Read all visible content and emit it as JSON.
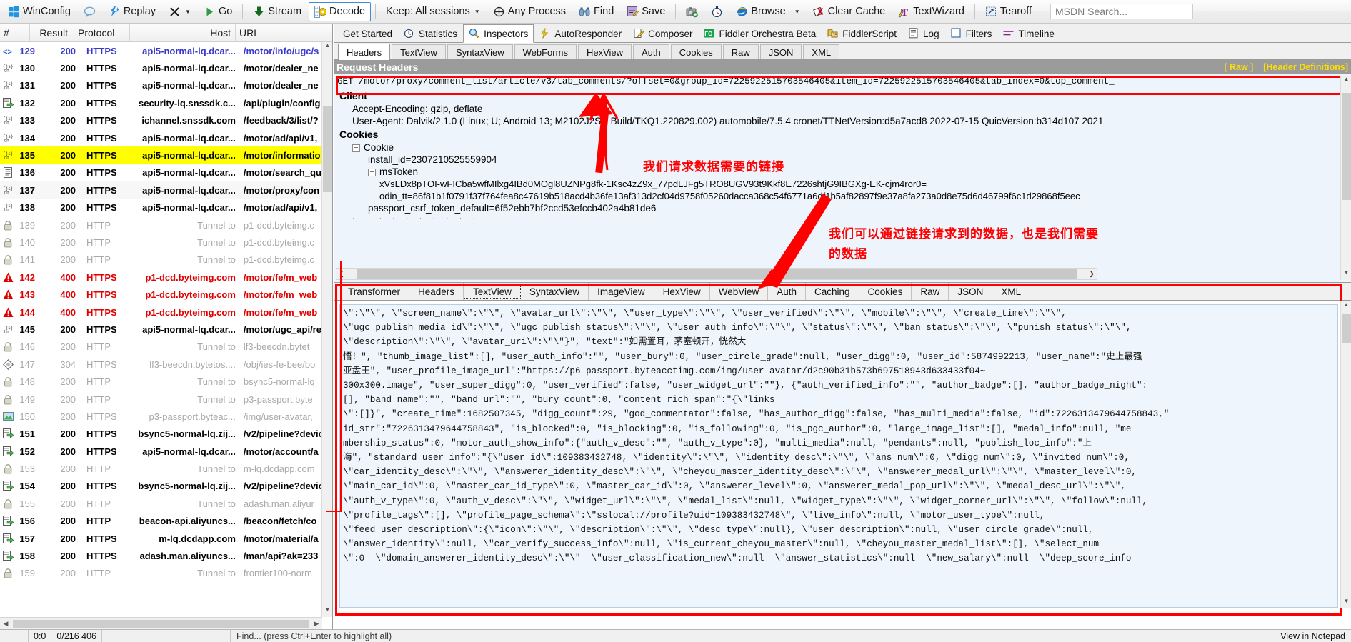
{
  "toolbar": {
    "items": [
      {
        "id": "winconfig",
        "label": "WinConfig",
        "icon": "windows-icon"
      },
      {
        "id": "comment",
        "label": "",
        "icon": "speech-bubble-icon"
      },
      {
        "id": "replay",
        "label": "Replay",
        "icon": "replay-icon"
      },
      {
        "id": "remove",
        "label": "",
        "icon": "x-icon",
        "caret": true
      },
      {
        "id": "go",
        "label": "Go",
        "icon": "play-icon"
      },
      {
        "id": "stream",
        "label": "Stream",
        "icon": "down-arrow-icon"
      },
      {
        "id": "decode",
        "label": "Decode",
        "icon": "decode-icon"
      },
      {
        "id": "keep",
        "label": "Keep: All sessions",
        "icon": "",
        "caret": true
      },
      {
        "id": "anyprocess",
        "label": "Any Process",
        "icon": "target-icon"
      },
      {
        "id": "find",
        "label": "Find",
        "icon": "binoculars-icon"
      },
      {
        "id": "save",
        "label": "Save",
        "icon": "save-icon"
      },
      {
        "id": "screenshot",
        "label": "",
        "icon": "camera-icon"
      },
      {
        "id": "timer",
        "label": "",
        "icon": "stopwatch-icon"
      },
      {
        "id": "browse",
        "label": "Browse",
        "icon": "ie-icon",
        "caret": true
      },
      {
        "id": "clearcache",
        "label": "Clear Cache",
        "icon": "clear-cache-icon"
      },
      {
        "id": "textwizard",
        "label": "TextWizard",
        "icon": "textwizard-icon"
      },
      {
        "id": "tearoff",
        "label": "Tearoff",
        "icon": "tearoff-icon"
      }
    ],
    "msdn_placeholder": "MSDN Search..."
  },
  "sessions": {
    "columns": [
      "#",
      "Result",
      "Protocol",
      "Host",
      "URL"
    ],
    "rows": [
      {
        "icon": "xml-icon",
        "num": "129",
        "result": "200",
        "protocol": "HTTPS",
        "host": "api5-normal-lq.dcar...",
        "url": "/motor/info/ugc/s",
        "style": "blue"
      },
      {
        "icon": "json-icon",
        "num": "130",
        "result": "200",
        "protocol": "HTTPS",
        "host": "api5-normal-lq.dcar...",
        "url": "/motor/dealer_ne",
        "style": "normal"
      },
      {
        "icon": "json-icon",
        "num": "131",
        "result": "200",
        "protocol": "HTTPS",
        "host": "api5-normal-lq.dcar...",
        "url": "/motor/dealer_ne",
        "style": "normal"
      },
      {
        "icon": "doc-arrow-icon",
        "num": "132",
        "result": "200",
        "protocol": "HTTPS",
        "host": "security-lq.snssdk.c...",
        "url": "/api/plugin/config",
        "style": "normal"
      },
      {
        "icon": "json-icon",
        "num": "133",
        "result": "200",
        "protocol": "HTTPS",
        "host": "ichannel.snssdk.com",
        "url": "/feedback/3/list/?",
        "style": "normal"
      },
      {
        "icon": "json-icon",
        "num": "134",
        "result": "200",
        "protocol": "HTTPS",
        "host": "api5-normal-lq.dcar...",
        "url": "/motor/ad/api/v1,",
        "style": "normal"
      },
      {
        "icon": "json-icon",
        "num": "135",
        "result": "200",
        "protocol": "HTTPS",
        "host": "api5-normal-lq.dcar...",
        "url": "/motor/informatio",
        "style": "selected"
      },
      {
        "icon": "text-icon",
        "num": "136",
        "result": "200",
        "protocol": "HTTPS",
        "host": "api5-normal-lq.dcar...",
        "url": "/motor/search_qu",
        "style": "normal"
      },
      {
        "icon": "json-icon",
        "num": "137",
        "result": "200",
        "protocol": "HTTPS",
        "host": "api5-normal-lq.dcar...",
        "url": "/motor/proxy/con",
        "style": "alt"
      },
      {
        "icon": "json-icon",
        "num": "138",
        "result": "200",
        "protocol": "HTTPS",
        "host": "api5-normal-lq.dcar...",
        "url": "/motor/ad/api/v1,",
        "style": "normal"
      },
      {
        "icon": "lock-icon",
        "num": "139",
        "result": "200",
        "protocol": "HTTP",
        "host": "Tunnel to",
        "url": "p1-dcd.byteimg.c",
        "style": "gray"
      },
      {
        "icon": "lock-icon",
        "num": "140",
        "result": "200",
        "protocol": "HTTP",
        "host": "Tunnel to",
        "url": "p1-dcd.byteimg.c",
        "style": "gray"
      },
      {
        "icon": "lock-icon",
        "num": "141",
        "result": "200",
        "protocol": "HTTP",
        "host": "Tunnel to",
        "url": "p1-dcd.byteimg.c",
        "style": "gray"
      },
      {
        "icon": "warning-icon",
        "num": "142",
        "result": "400",
        "protocol": "HTTPS",
        "host": "p1-dcd.byteimg.com",
        "url": "/motor/fe/m_web",
        "style": "red"
      },
      {
        "icon": "warning-icon",
        "num": "143",
        "result": "400",
        "protocol": "HTTPS",
        "host": "p1-dcd.byteimg.com",
        "url": "/motor/fe/m_web",
        "style": "red"
      },
      {
        "icon": "warning-icon",
        "num": "144",
        "result": "400",
        "protocol": "HTTPS",
        "host": "p1-dcd.byteimg.com",
        "url": "/motor/fe/m_web",
        "style": "red"
      },
      {
        "icon": "json-icon",
        "num": "145",
        "result": "200",
        "protocol": "HTTPS",
        "host": "api5-normal-lq.dcar...",
        "url": "/motor/ugc_api/re",
        "style": "normal"
      },
      {
        "icon": "lock-icon",
        "num": "146",
        "result": "200",
        "protocol": "HTTP",
        "host": "Tunnel to",
        "url": "lf3-beecdn.bytet",
        "style": "gray"
      },
      {
        "icon": "cache-icon",
        "num": "147",
        "result": "304",
        "protocol": "HTTPS",
        "host": "lf3-beecdn.bytetos....",
        "url": "/obj/ies-fe-bee/bo",
        "style": "gray"
      },
      {
        "icon": "lock-icon",
        "num": "148",
        "result": "200",
        "protocol": "HTTP",
        "host": "Tunnel to",
        "url": "bsync5-normal-lq",
        "style": "gray"
      },
      {
        "icon": "lock-icon",
        "num": "149",
        "result": "200",
        "protocol": "HTTP",
        "host": "Tunnel to",
        "url": "p3-passport.byte",
        "style": "gray"
      },
      {
        "icon": "image-icon",
        "num": "150",
        "result": "200",
        "protocol": "HTTPS",
        "host": "p3-passport.byteac...",
        "url": "/img/user-avatar,",
        "style": "gray"
      },
      {
        "icon": "doc-arrow-icon",
        "num": "151",
        "result": "200",
        "protocol": "HTTPS",
        "host": "bsync5-normal-lq.zij...",
        "url": "/v2/pipeline?devic",
        "style": "normal"
      },
      {
        "icon": "doc-arrow-icon",
        "num": "152",
        "result": "200",
        "protocol": "HTTPS",
        "host": "api5-normal-lq.dcar...",
        "url": "/motor/account/a",
        "style": "normal"
      },
      {
        "icon": "lock-icon",
        "num": "153",
        "result": "200",
        "protocol": "HTTP",
        "host": "Tunnel to",
        "url": "m-lq.dcdapp.com",
        "style": "gray"
      },
      {
        "icon": "doc-arrow-icon",
        "num": "154",
        "result": "200",
        "protocol": "HTTPS",
        "host": "bsync5-normal-lq.zij...",
        "url": "/v2/pipeline?devic",
        "style": "normal"
      },
      {
        "icon": "lock-icon",
        "num": "155",
        "result": "200",
        "protocol": "HTTP",
        "host": "Tunnel to",
        "url": "adash.man.aliyur",
        "style": "gray"
      },
      {
        "icon": "doc-arrow-icon",
        "num": "156",
        "result": "200",
        "protocol": "HTTP",
        "host": "beacon-api.aliyuncs...",
        "url": "/beacon/fetch/co",
        "style": "normal"
      },
      {
        "icon": "doc-arrow-icon",
        "num": "157",
        "result": "200",
        "protocol": "HTTPS",
        "host": "m-lq.dcdapp.com",
        "url": "/motor/material/a",
        "style": "normal"
      },
      {
        "icon": "doc-arrow-icon",
        "num": "158",
        "result": "200",
        "protocol": "HTTPS",
        "host": "adash.man.aliyuncs...",
        "url": "/man/api?ak=233",
        "style": "normal"
      },
      {
        "icon": "lock-icon",
        "num": "159",
        "result": "200",
        "protocol": "HTTP",
        "host": "Tunnel to",
        "url": "frontier100-norm",
        "style": "gray"
      }
    ]
  },
  "main_tabs": [
    {
      "label": "Get Started",
      "icon": "",
      "active": false
    },
    {
      "label": "Statistics",
      "icon": "stopwatch-icon",
      "active": false
    },
    {
      "label": "Inspectors",
      "icon": "magnifier-icon",
      "active": true
    },
    {
      "label": "AutoResponder",
      "icon": "bolt-icon",
      "active": false
    },
    {
      "label": "Composer",
      "icon": "pencil-icon",
      "active": false
    },
    {
      "label": "Fiddler Orchestra Beta",
      "icon": "fo-icon",
      "active": false
    },
    {
      "label": "FiddlerScript",
      "icon": "script-icon",
      "active": false
    },
    {
      "label": "Log",
      "icon": "log-icon",
      "active": false
    },
    {
      "label": "Filters",
      "icon": "filter-icon",
      "active": false
    },
    {
      "label": "Timeline",
      "icon": "timeline-icon",
      "active": false
    }
  ],
  "request_tabs": [
    {
      "label": "Headers",
      "active": true
    },
    {
      "label": "TextView",
      "active": false
    },
    {
      "label": "SyntaxView",
      "active": false
    },
    {
      "label": "WebForms",
      "active": false
    },
    {
      "label": "HexView",
      "active": false
    },
    {
      "label": "Auth",
      "active": false
    },
    {
      "label": "Cookies",
      "active": false
    },
    {
      "label": "Raw",
      "active": false
    },
    {
      "label": "JSON",
      "active": false
    },
    {
      "label": "XML",
      "active": false
    }
  ],
  "request": {
    "header_bar_title": "Request Headers",
    "raw_link": "[ Raw ]",
    "header_def_link": "[Header Definitions]",
    "request_line": "GET /motor/proxy/comment_list/article/v3/tab_comments/?offset=0&group_id=7225922515703546405&item_id=7225922515703546405&tab_index=0&top_comment_",
    "client_section": "Client",
    "client_headers": [
      "Accept-Encoding: gzip, deflate",
      "User-Agent: Dalvik/2.1.0 (Linux; U; Android 13; M2102J2SC Build/TKQ1.220829.002) automobile/7.5.4 cronet/TTNetVersion:d5a7acd8 2022-07-15 QuicVersion:b314d107 2021"
    ],
    "cookies_section": "Cookies",
    "cookie_node": "Cookie",
    "install_id": "install_id=2307210525559904",
    "mstoken_node": "msToken",
    "mstoken_value": "xVsLDx8pTOI-wFICba5wfMIlxg4IBd0MOgl8UZNPg8fk-1Ksc4zZ9x_77pdLJFg5TRO8UGV93t9Kkf8E7226shtjG9IBGXg-EK-cjm4ror0=",
    "odin_tt": "odin_tt=86f81b1f0791f37f764fea8c47619b518acd4b36fe13af313d2cf04d9758f05260dacca368c54f6771a6df1b5af82897f9e37a8fa273a0d8e75d6d46799f6c1d29868f5eec",
    "passport_csrf": "passport_csrf_token_default=6f52ebb7bf2ccd53efccb402a4b81de6"
  },
  "response_tabs": [
    {
      "label": "Transformer",
      "active": false
    },
    {
      "label": "Headers",
      "active": false
    },
    {
      "label": "TextView",
      "active": true
    },
    {
      "label": "SyntaxView",
      "active": false
    },
    {
      "label": "ImageView",
      "active": false
    },
    {
      "label": "HexView",
      "active": false
    },
    {
      "label": "WebView",
      "active": false
    },
    {
      "label": "Auth",
      "active": false
    },
    {
      "label": "Caching",
      "active": false
    },
    {
      "label": "Cookies",
      "active": false
    },
    {
      "label": "Raw",
      "active": false
    },
    {
      "label": "JSON",
      "active": false
    },
    {
      "label": "XML",
      "active": false
    }
  ],
  "response": {
    "body": "\\\":\\\"\\\", \\\"screen_name\\\":\\\"\\\", \\\"avatar_url\\\":\\\"\\\", \\\"user_type\\\":\\\"\\\", \\\"user_verified\\\":\\\"\\\", \\\"mobile\\\":\\\"\\\", \\\"create_time\\\":\\\"\\\",\n\\\"ugc_publish_media_id\\\":\\\"\\\", \\\"ugc_publish_status\\\":\\\"\\\", \\\"user_auth_info\\\":\\\"\\\", \\\"status\\\":\\\"\\\", \\\"ban_status\\\":\\\"\\\", \\\"punish_status\\\":\\\"\\\",\n\\\"description\\\":\\\"\\\", \\\"avatar_uri\\\":\\\"\\\"}\", \"text\":\"如需置耳，茅塞顿开，恍然大\n悟！\", \"thumb_image_list\":[], \"user_auth_info\":\"\", \"user_bury\":0, \"user_circle_grade\":null, \"user_digg\":0, \"user_id\":5874992213, \"user_name\":\"史上最强\n亚盘王\", \"user_profile_image_url\":\"https://p6-passport.byteacctimg.com/img/user-avatar/d2c90b31b573b697518943d633433f04~\n300x300.image\", \"user_super_digg\":0, \"user_verified\":false, \"user_widget_url\":\"\"}, {\"auth_verified_info\":\"\", \"author_badge\":[], \"author_badge_night\":\n[], \"band_name\":\"\", \"band_url\":\"\", \"bury_count\":0, \"content_rich_span\":\"{\\\"links\n\\\":[]}\", \"create_time\":1682507345, \"digg_count\":29, \"god_commentator\":false, \"has_author_digg\":false, \"has_multi_media\":false, \"id\":7226313479644758843,\"\nid_str\":\"7226313479644758843\", \"is_blocked\":0, \"is_blocking\":0, \"is_following\":0, \"is_pgc_author\":0, \"large_image_list\":[], \"medal_info\":null, \"me\nmbership_status\":0, \"motor_auth_show_info\":{\"auth_v_desc\":\"\", \"auth_v_type\":0}, \"multi_media\":null, \"pendants\":null, \"publish_loc_info\":\"上\n海\", \"standard_user_info\":\"{\\\"user_id\\\":109383432748, \\\"identity\\\":\\\"\\\", \\\"identity_desc\\\":\\\"\\\", \\\"ans_num\\\":0, \\\"digg_num\\\":0, \\\"invited_num\\\":0,\n\\\"car_identity_desc\\\":\\\"\\\", \\\"answerer_identity_desc\\\":\\\"\\\", \\\"cheyou_master_identity_desc\\\":\\\"\\\", \\\"answerer_medal_url\\\":\\\"\\\", \\\"master_level\\\":0,\n\\\"main_car_id\\\":0, \\\"master_car_id_type\\\":0, \\\"master_car_id\\\":0, \\\"answerer_level\\\":0, \\\"answerer_medal_pop_url\\\":\\\"\\\", \\\"medal_desc_url\\\":\\\"\\\",\n\\\"auth_v_type\\\":0, \\\"auth_v_desc\\\":\\\"\\\", \\\"widget_url\\\":\\\"\\\", \\\"medal_list\\\":null, \\\"widget_type\\\":\\\"\\\", \\\"widget_corner_url\\\":\\\"\\\", \\\"follow\\\":null,\n\\\"profile_tags\\\":[], \\\"profile_page_schema\\\":\\\"sslocal://profile?uid=109383432748\\\", \\\"live_info\\\":null, \\\"motor_user_type\\\":null,\n\\\"feed_user_description\\\":{\\\"icon\\\":\\\"\\\", \\\"description\\\":\\\"\\\", \\\"desc_type\\\":null}, \\\"user_description\\\":null, \\\"user_circle_grade\\\":null,\n\\\"answer_identity\\\":null, \\\"car_verify_success_info\\\":null, \\\"is_current_cheyou_master\\\":null, \\\"cheyou_master_medal_list\\\":[], \\\"select_num\n\\\":0  \\\"domain_answerer_identity_desc\\\":\\\"\\\"  \\\"user_classification_new\\\":null  \\\"answer_statistics\\\":null  \\\"new_salary\\\":null  \\\"deep_score_info"
  },
  "annotations": {
    "note1": "我们请求数据需要的链接",
    "note2_line1": "我们可以通过链接请求到的数据，也是我们需要",
    "note2_line2": "的数据"
  },
  "statusbar": {
    "coords": "0:0",
    "counts": "0/216  406",
    "find_hint": "Find... (press Ctrl+Enter to highlight all)",
    "view_note": "View in Notepad"
  }
}
